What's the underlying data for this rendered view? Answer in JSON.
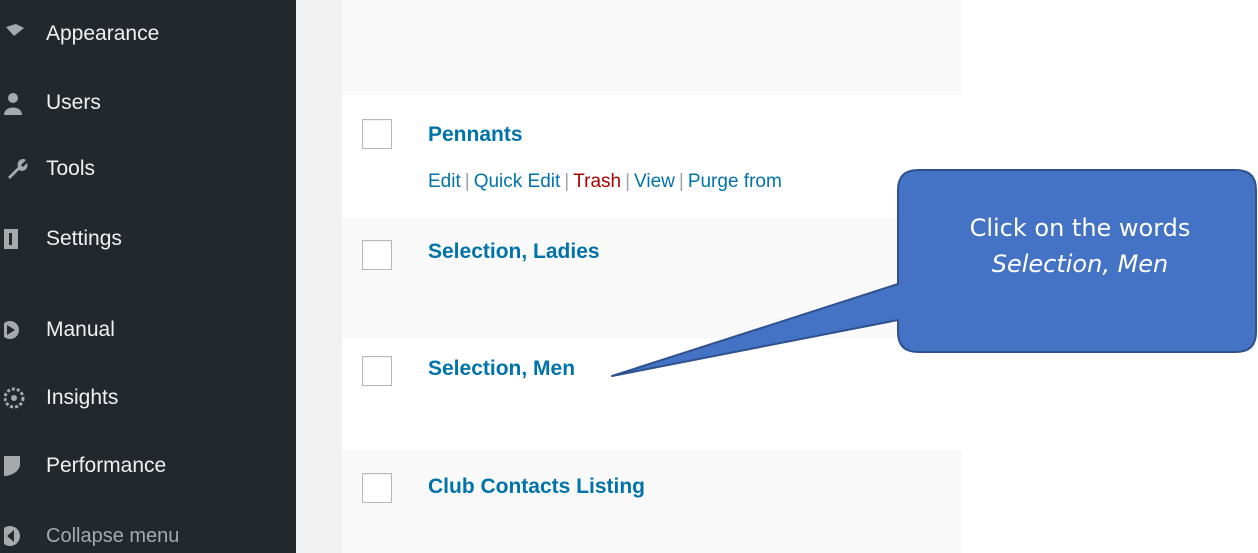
{
  "sidebar": {
    "items": [
      {
        "label": "Appearance",
        "icon": "paintbrush-icon"
      },
      {
        "label": "Users",
        "icon": "users-icon"
      },
      {
        "label": "Tools",
        "icon": "wrench-icon"
      },
      {
        "label": "Settings",
        "icon": "settings-icon"
      },
      {
        "label": "Manual",
        "icon": "manual-icon"
      },
      {
        "label": "Insights",
        "icon": "insights-icon"
      },
      {
        "label": "Performance",
        "icon": "performance-icon"
      },
      {
        "label": "Collapse menu",
        "icon": "collapse-icon"
      }
    ]
  },
  "pages": {
    "rows": [
      {
        "title": "Pennants",
        "actions": [
          "Edit",
          "Quick Edit",
          "Trash",
          "View",
          "Purge from"
        ]
      },
      {
        "title": "Selection, Ladies"
      },
      {
        "title": "Selection, Men"
      },
      {
        "title": "Club Contacts Listing"
      }
    ]
  },
  "callout": {
    "line1": "Click on the words",
    "line2": "Selection, Men",
    "color": "#4472c4"
  },
  "colors": {
    "sidebar_bg": "#23282d",
    "link": "#0073aa",
    "trash": "#aa0000"
  }
}
